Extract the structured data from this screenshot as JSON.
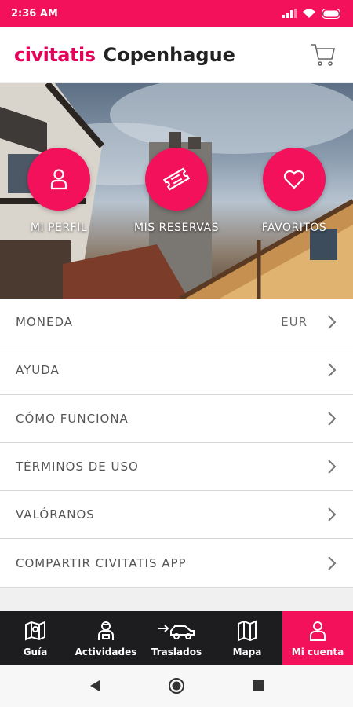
{
  "status_bar": {
    "time": "2:36 AM"
  },
  "header": {
    "brand": "civitatis",
    "city": "Copenhague"
  },
  "hero_actions": [
    {
      "label": "MI PERFIL",
      "icon": "user-icon"
    },
    {
      "label": "MIS RESERVAS",
      "icon": "ticket-icon"
    },
    {
      "label": "FAVORITOS",
      "icon": "heart-icon"
    }
  ],
  "menu": {
    "items": [
      {
        "label": "MONEDA",
        "value": "EUR"
      },
      {
        "label": "AYUDA"
      },
      {
        "label": "CÓMO FUNCIONA"
      },
      {
        "label": "TÉRMINOS DE USO"
      },
      {
        "label": "VALÓRANOS"
      },
      {
        "label": "COMPARTIR CIVITATIS APP"
      }
    ]
  },
  "bottom_nav": {
    "items": [
      {
        "label": "Guía",
        "icon": "guide-map-icon"
      },
      {
        "label": "Actividades",
        "icon": "guide-person-icon"
      },
      {
        "label": "Traslados",
        "icon": "car-transfer-icon"
      },
      {
        "label": "Mapa",
        "icon": "map-icon"
      },
      {
        "label": "Mi cuenta",
        "icon": "user-icon",
        "active": true
      }
    ]
  },
  "colors": {
    "brand": "#f2115a",
    "nav_bg": "#1d1d1f"
  }
}
